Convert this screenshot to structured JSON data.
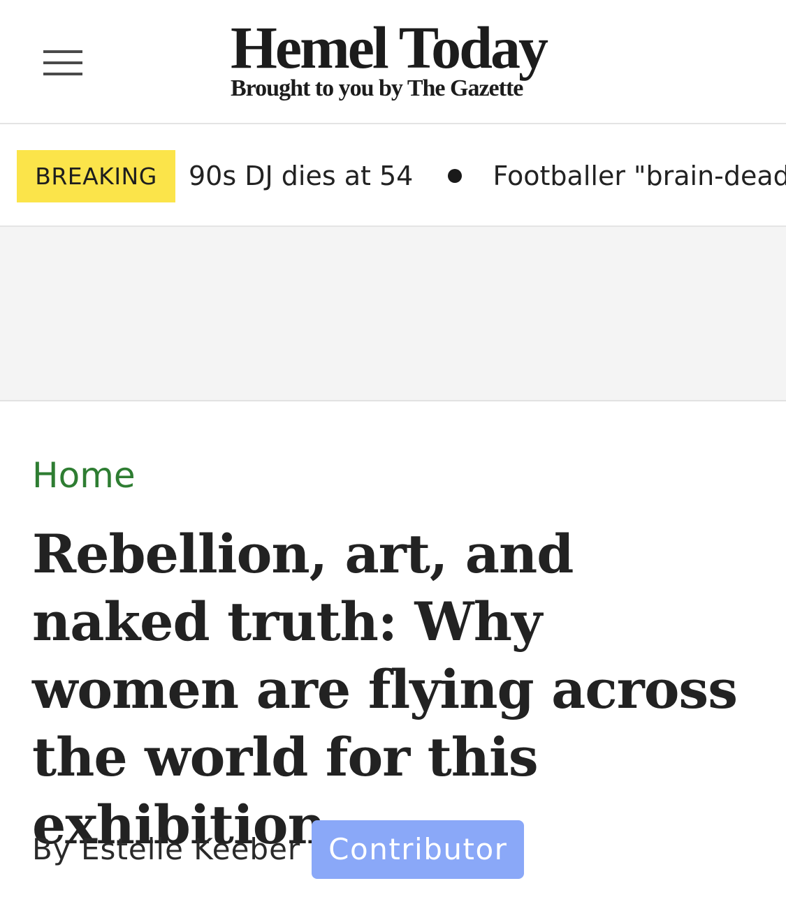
{
  "header": {
    "logo_title": "Hemel Today",
    "logo_subtitle": "Brought to you by The Gazette",
    "menu_icon": "hamburger-menu-icon"
  },
  "ticker": {
    "badge": "BREAKING",
    "items": [
      "90s DJ dies at 54",
      "Footballer \"brain-dead\""
    ],
    "badge_color": "#fbe44a"
  },
  "article": {
    "breadcrumb": "Home",
    "headline": "Rebellion, art, and naked truth: Why women are flying across the world for this exhibition",
    "byline": "By Estelle Keeber",
    "author_role": "Contributor",
    "breadcrumb_color": "#2e7d32",
    "role_badge_color": "#8aa8f8"
  }
}
